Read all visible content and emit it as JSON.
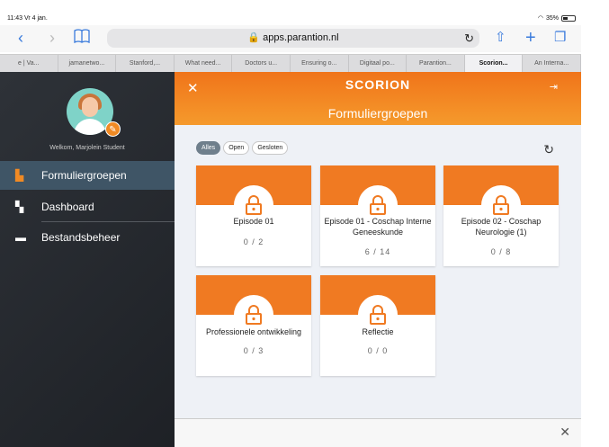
{
  "status": {
    "time": "11:43",
    "date": "Vr 4 jan.",
    "battery": "35%"
  },
  "browser": {
    "url": "apps.parantion.nl",
    "tabs": [
      "e | Va...",
      "jamanetwo...",
      "Stanford,...",
      "What need...",
      "Doctors u...",
      "Ensuring o...",
      "Digitaal po...",
      "Parantion...",
      "Scorion...",
      "An Interna..."
    ],
    "active_tab": 8
  },
  "sidebar": {
    "welcome": "Welkom, Marjolein Student",
    "items": [
      {
        "label": "Formuliergroepen",
        "icon": "briefcase-icon",
        "selected": true
      },
      {
        "label": "Dashboard",
        "icon": "dashboard-icon",
        "selected": false
      },
      {
        "label": "Bestandsbeheer",
        "icon": "folder-icon",
        "selected": false
      }
    ]
  },
  "header": {
    "logo": "SCORION",
    "title": "Formuliergroepen"
  },
  "filters": [
    "Alles",
    "Open",
    "Gesloten"
  ],
  "cards": [
    {
      "title": "Episode 01",
      "count": "0 / 2"
    },
    {
      "title": "Episode 01 - Coschap Interne Geneeskunde",
      "count": "6 / 14"
    },
    {
      "title": "Episode 02 - Coschap Neurologie (1)",
      "count": "0 / 8"
    },
    {
      "title": "Professionele ontwikkeling",
      "count": "0 / 3"
    },
    {
      "title": "Reflectie",
      "count": "0 / 0"
    }
  ],
  "colors": {
    "accent": "#f07a22",
    "sidebar": "#23262b",
    "selected": "#3f5566"
  }
}
